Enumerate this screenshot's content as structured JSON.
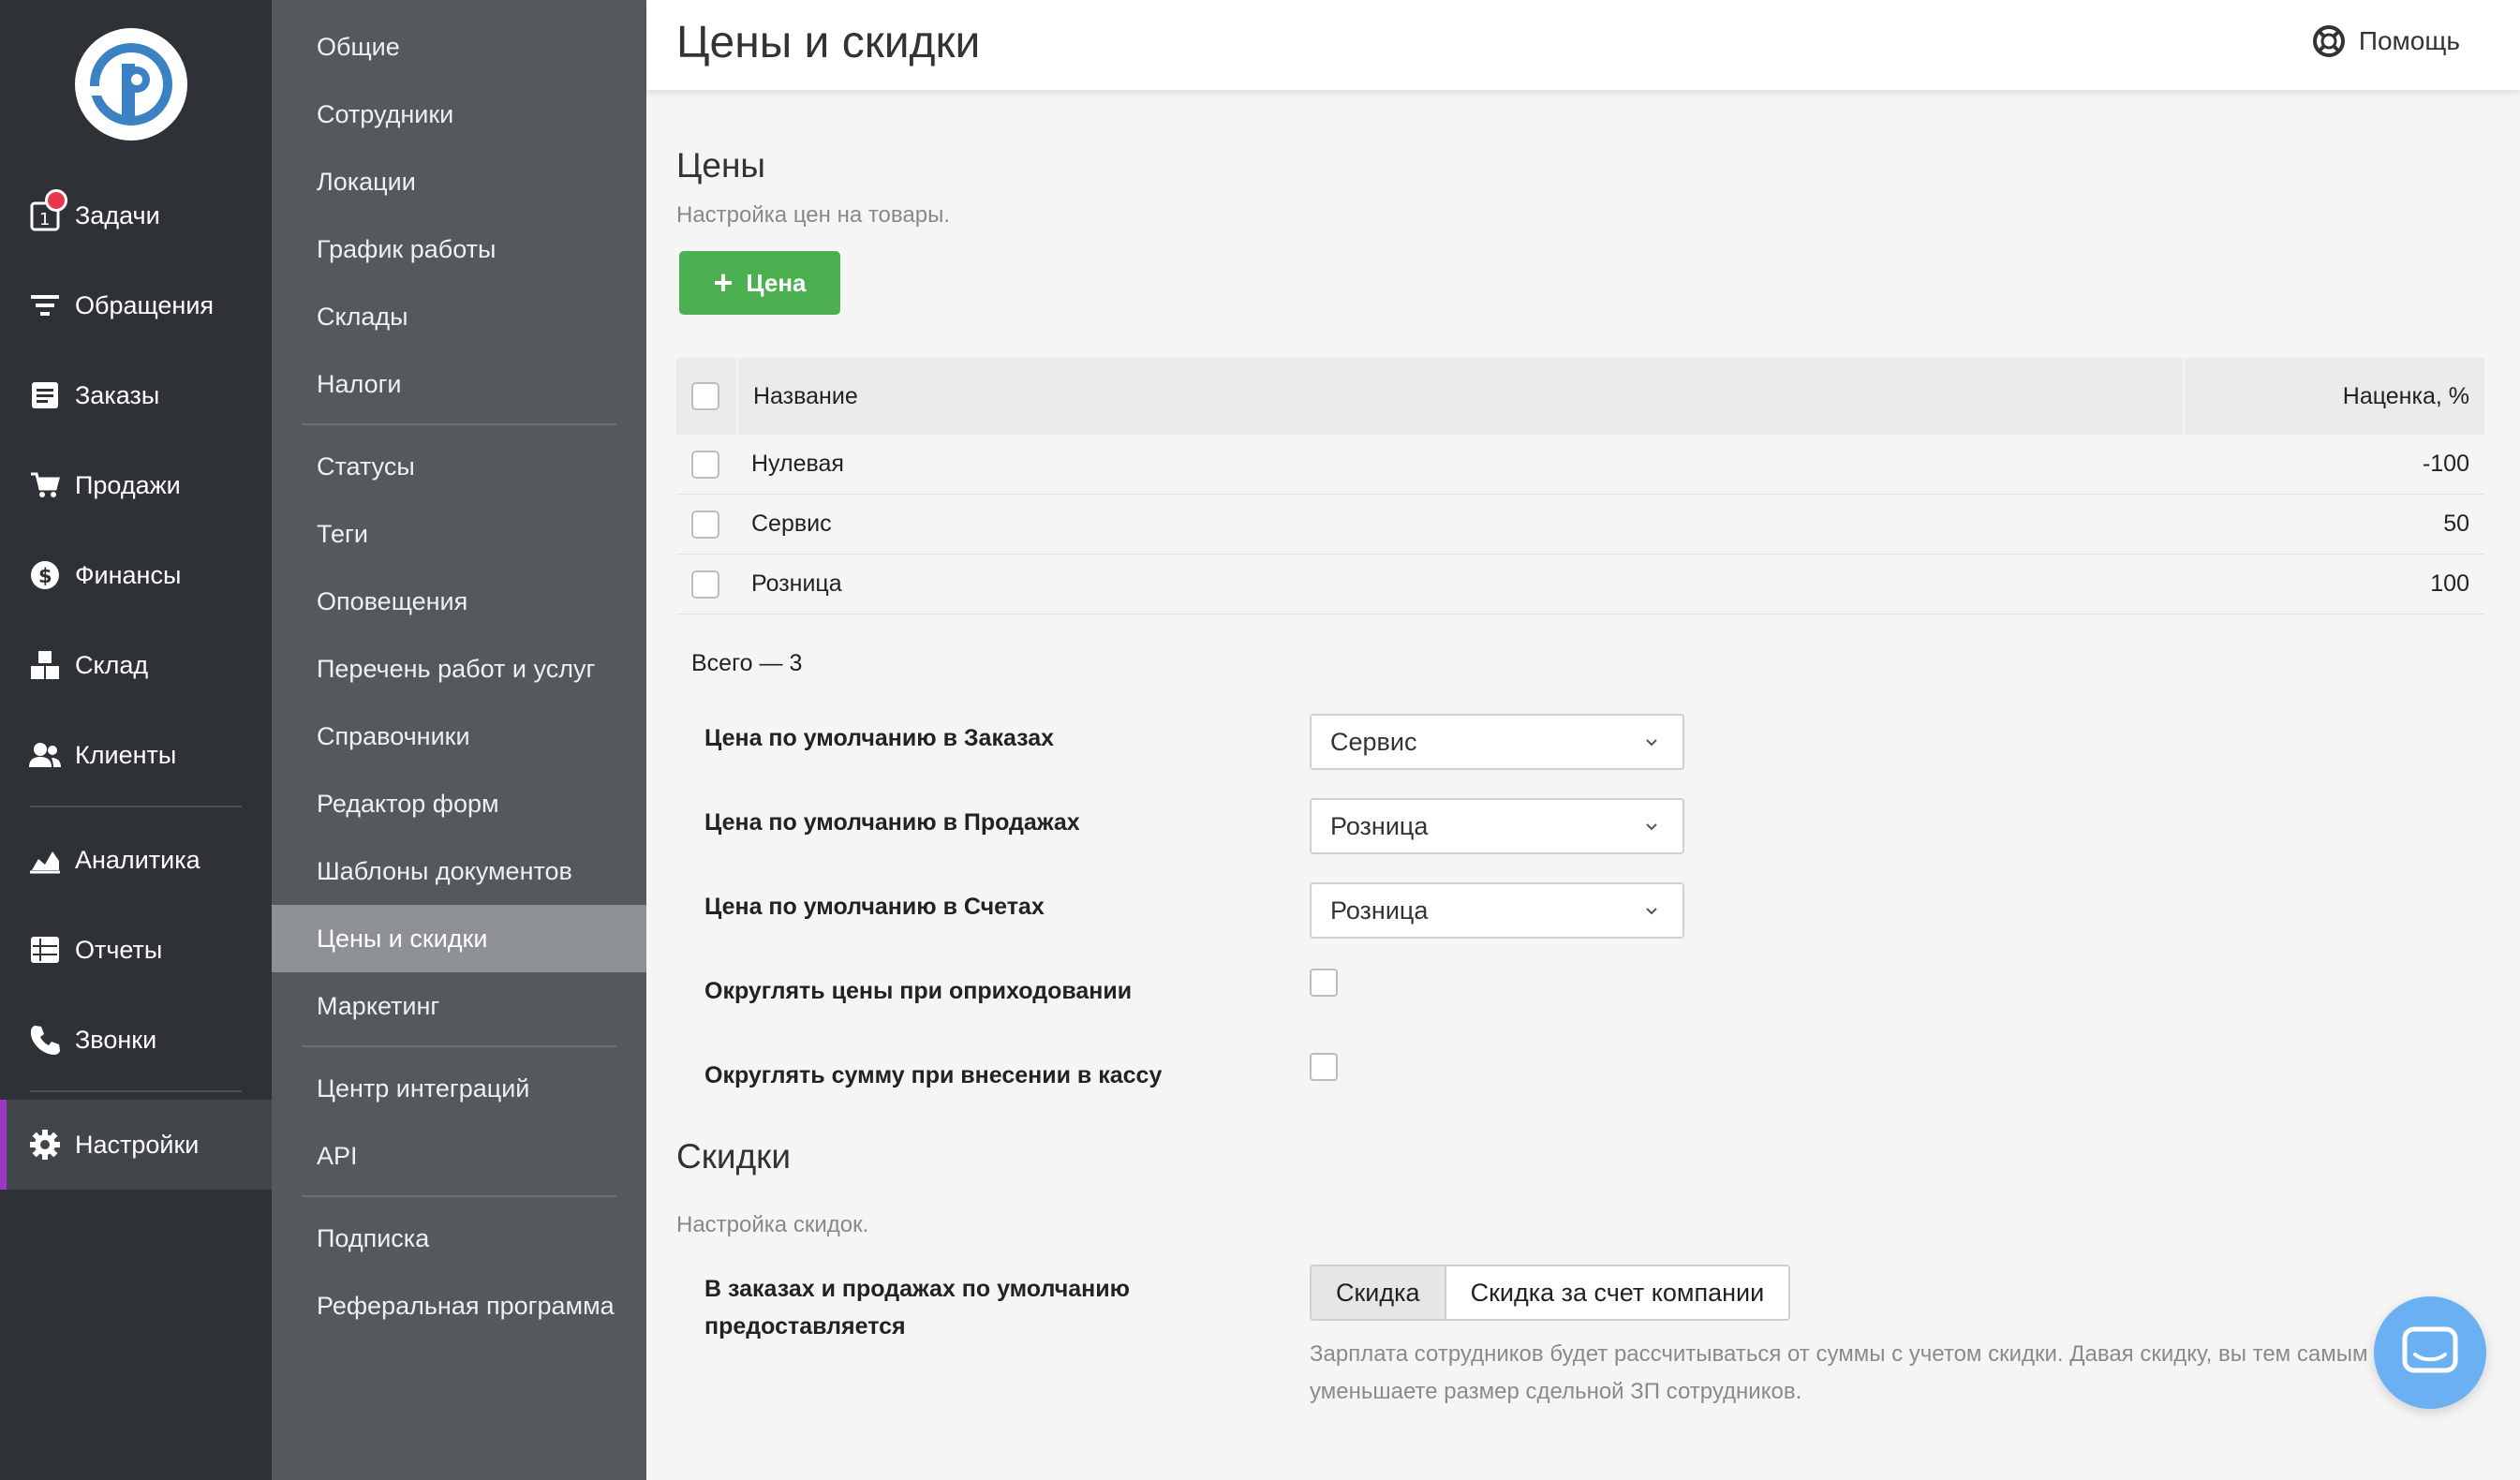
{
  "nav": {
    "items": [
      {
        "label": "Задачи",
        "icon": "tasks-icon",
        "badge": "1"
      },
      {
        "label": "Обращения",
        "icon": "filter-icon"
      },
      {
        "label": "Заказы",
        "icon": "orders-icon"
      },
      {
        "label": "Продажи",
        "icon": "cart-icon"
      },
      {
        "label": "Финансы",
        "icon": "dollar-icon"
      },
      {
        "label": "Склад",
        "icon": "boxes-icon"
      },
      {
        "label": "Клиенты",
        "icon": "users-icon"
      },
      {
        "label": "Аналитика",
        "icon": "chart-area-icon"
      },
      {
        "label": "Отчеты",
        "icon": "reports-icon"
      },
      {
        "label": "Звонки",
        "icon": "phone-icon"
      },
      {
        "label": "Настройки",
        "icon": "gear-icon",
        "active": true
      }
    ]
  },
  "submenu": {
    "items": [
      {
        "label": "Общие"
      },
      {
        "label": "Сотрудники"
      },
      {
        "label": "Локации"
      },
      {
        "label": "График работы"
      },
      {
        "label": "Склады"
      },
      {
        "label": "Налоги"
      },
      {
        "label": "Статусы"
      },
      {
        "label": "Теги"
      },
      {
        "label": "Оповещения"
      },
      {
        "label": "Перечень работ и услуг"
      },
      {
        "label": "Справочники"
      },
      {
        "label": "Редактор форм"
      },
      {
        "label": "Шаблоны документов"
      },
      {
        "label": "Цены и скидки",
        "active": true
      },
      {
        "label": "Маркетинг"
      },
      {
        "label": "Центр интеграций"
      },
      {
        "label": "API"
      },
      {
        "label": "Подписка"
      },
      {
        "label": "Реферальная программа"
      }
    ]
  },
  "header": {
    "title": "Цены и скидки",
    "help_label": "Помощь"
  },
  "prices": {
    "title": "Цены",
    "subtitle": "Настройка цен на товары.",
    "add_button_label": "Цена",
    "table": {
      "columns": [
        "Название",
        "Наценка, %"
      ],
      "rows": [
        {
          "name": "Нулевая",
          "markup": "-100"
        },
        {
          "name": "Сервис",
          "markup": "50"
        },
        {
          "name": "Розница",
          "markup": "100"
        }
      ]
    },
    "total": "Всего — 3",
    "settings": {
      "default_orders_label": "Цена по умолчанию в Заказах",
      "default_orders_value": "Сервис",
      "default_sales_label": "Цена по умолчанию в Продажах",
      "default_sales_value": "Розница",
      "default_invoices_label": "Цена по умолчанию в Счетах",
      "default_invoices_value": "Розница",
      "round_receiving_label": "Округлять цены при оприходовании",
      "round_receiving_checked": false,
      "round_cash_label": "Округлять сумму при внесении в кассу",
      "round_cash_checked": false
    }
  },
  "discounts": {
    "title": "Скидки",
    "subtitle": "Настройка скидок.",
    "default_label_line1": "В заказах и продажах по умолчанию",
    "default_label_line2": "предоставляется",
    "options": [
      "Скидка",
      "Скидка за счет компании"
    ],
    "selected": "Скидка",
    "note": "Зарплата сотрудников будет рассчитываться от суммы с учетом скидки. Давая скидку, вы тем самым уменьшаете размер сдельной ЗП сотрудников."
  },
  "colors": {
    "nav_bg": "#2e3236",
    "submenu_bg": "#54595d",
    "accent_green": "#4caf50",
    "accent_purple": "#9b36c7",
    "chat_blue": "#6ab0f3"
  }
}
